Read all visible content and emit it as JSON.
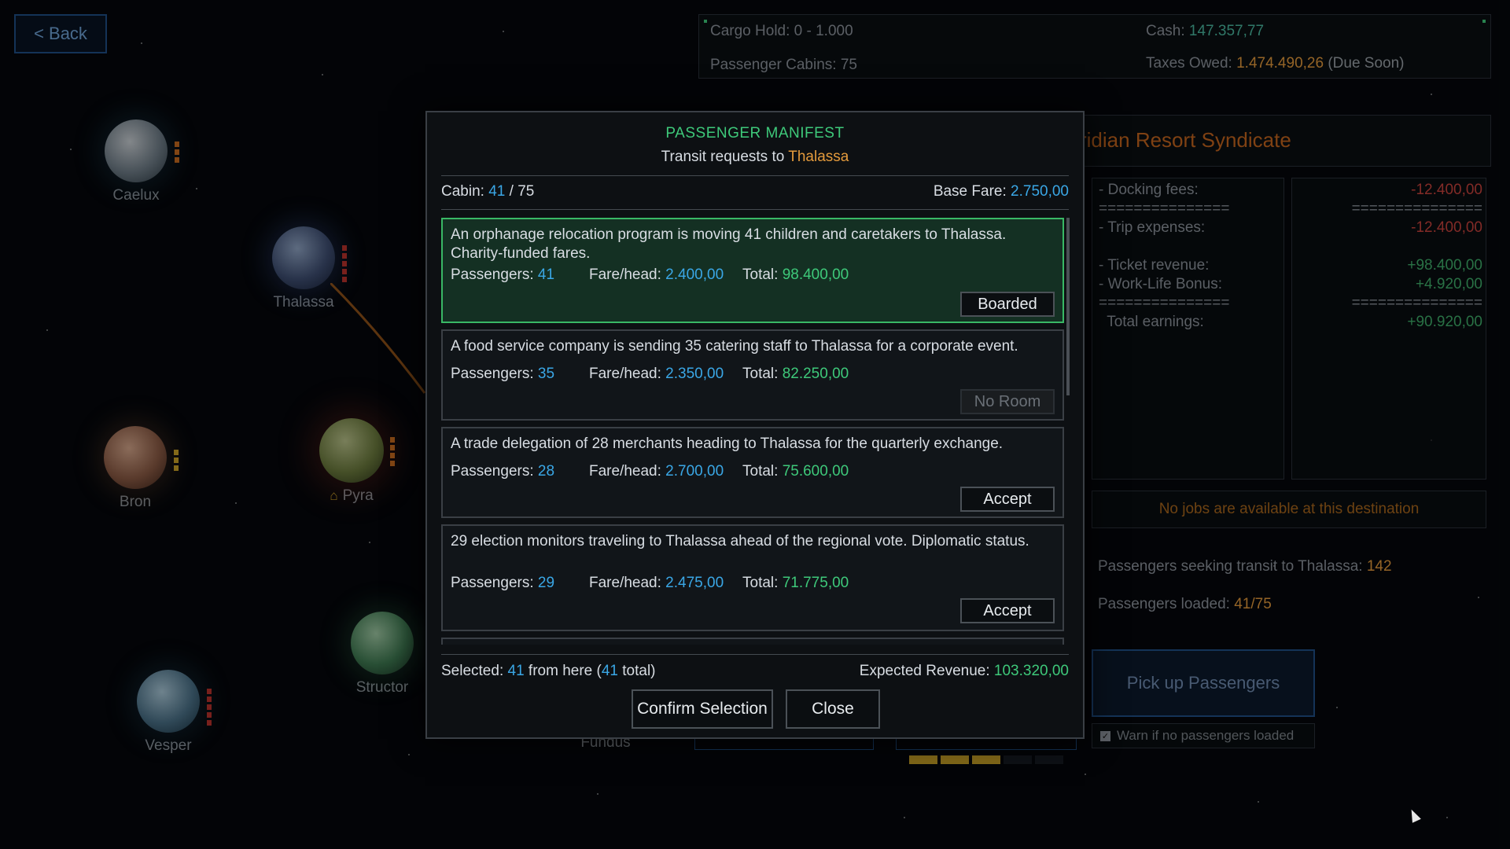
{
  "back_button": "< Back",
  "topbar": {
    "cargo": "Cargo Hold: 0 - 1.000",
    "cabins": "Passenger Cabins: 75",
    "cash_label": "Cash: ",
    "cash_value": "147.357,77",
    "taxes_label": "Taxes Owed: ",
    "taxes_value": "1.474.490,26",
    "taxes_note": " (Due Soon)"
  },
  "planets": [
    {
      "name": "Caelux"
    },
    {
      "name": "Thalassa"
    },
    {
      "name": "Bron"
    },
    {
      "name": "Pyra"
    },
    {
      "name": "Structor"
    },
    {
      "name": "Vesper"
    },
    {
      "name": "Fundus"
    }
  ],
  "right_panel": {
    "corp_title": "ridian Resort Syndicate",
    "ledger_left": [
      "- Docking fees:",
      "===============",
      "- Trip expenses:",
      "",
      "- Ticket revenue:",
      "- Work-Life Bonus:",
      "===============",
      "  Total earnings:"
    ],
    "ledger_right": [
      {
        "text": "-12.400,00",
        "color": "#c8423c"
      },
      {
        "text": "===============",
        "color": "#8c939b"
      },
      {
        "text": "-12.400,00",
        "color": "#c8423c"
      },
      {
        "text": "",
        "color": "#8c939b"
      },
      {
        "text": "+98.400,00",
        "color": "#3fae6a"
      },
      {
        "text": "+4.920,00",
        "color": "#3fae6a"
      },
      {
        "text": "===============",
        "color": "#8c939b"
      },
      {
        "text": "+90.920,00",
        "color": "#3fae6a"
      }
    ],
    "no_jobs": "No jobs are available at this destination",
    "seeking_label": "Passengers seeking transit to Thalassa: ",
    "seeking_value": "142",
    "loaded_label": "Passengers loaded: ",
    "loaded_value": "41/75",
    "pickup_button": "Pick up Passengers",
    "warn_label": "Warn if no passengers loaded",
    "warn_checked": true,
    "progress_filled": 3,
    "progress_total": 5
  },
  "modal": {
    "title": "PASSENGER MANIFEST",
    "subtitle_prefix": "Transit requests to ",
    "destination": "Thalassa",
    "cabin_label": "Cabin: ",
    "cabin_used": "41",
    "cabin_sep": " / ",
    "cabin_total": "75",
    "base_fare_label": "Base Fare: ",
    "base_fare_value": "2.750,00",
    "passengers_label": "Passengers: ",
    "fare_label": "Fare/head: ",
    "total_label": "Total: ",
    "requests": [
      {
        "description": "An orphanage relocation program is moving 41 children and caretakers to Thalassa. Charity-funded fares.",
        "passengers": "41",
        "fare": "2.400,00",
        "total": "98.400,00",
        "action": "Boarded",
        "state": "boarded"
      },
      {
        "description": "A food service company is sending 35 catering staff to Thalassa for a corporate event.",
        "passengers": "35",
        "fare": "2.350,00",
        "total": "82.250,00",
        "action": "No Room",
        "state": "disabled"
      },
      {
        "description": "A trade delegation of 28 merchants heading to Thalassa for the quarterly exchange.",
        "passengers": "28",
        "fare": "2.700,00",
        "total": "75.600,00",
        "action": "Accept",
        "state": "available"
      },
      {
        "description": "29 election monitors traveling to Thalassa ahead of the regional vote. Diplomatic status.",
        "passengers": "29",
        "fare": "2.475,00",
        "total": "71.775,00",
        "action": "Accept",
        "state": "available"
      }
    ],
    "selected_label": "Selected: ",
    "selected_here": "41",
    "selected_mid": " from here (",
    "selected_total": "41",
    "selected_end": " total)",
    "revenue_label": "Expected Revenue: ",
    "revenue_value": "103.320,00",
    "confirm_button": "Confirm Selection",
    "close_button": "Close"
  }
}
